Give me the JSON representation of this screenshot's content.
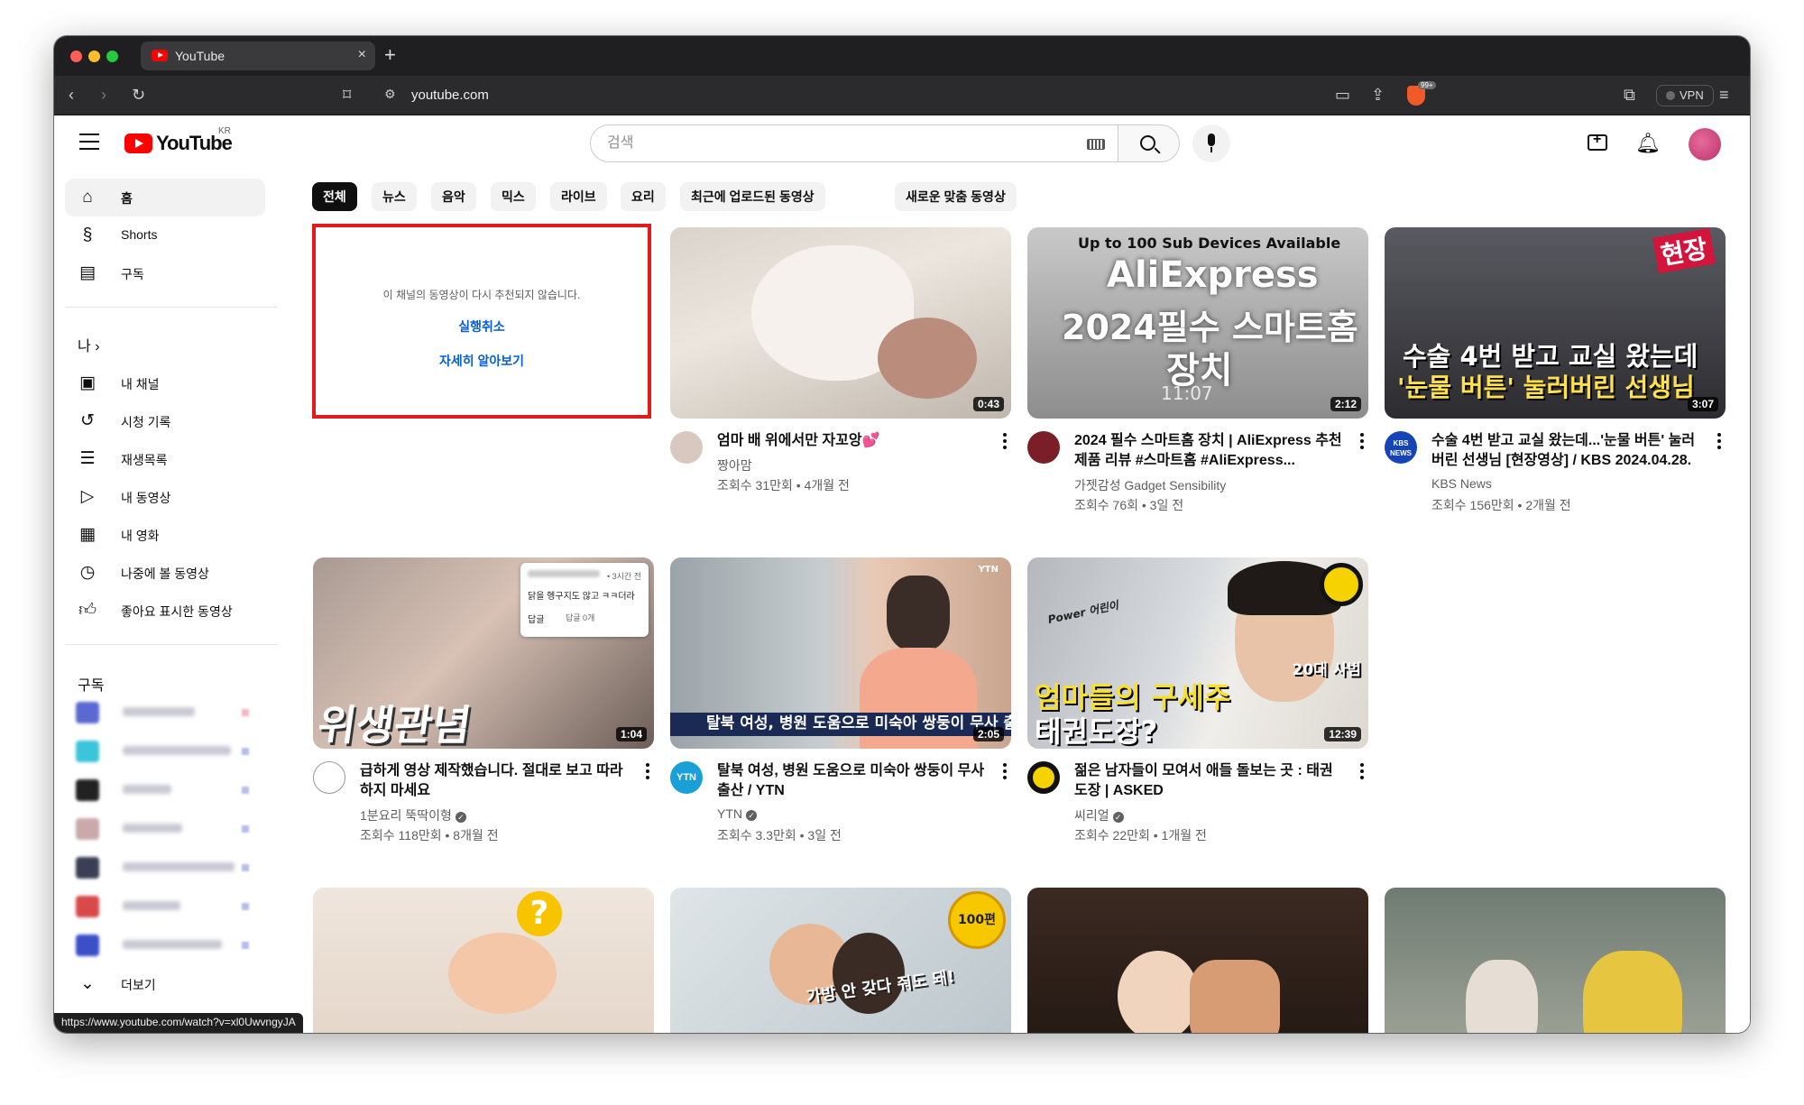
{
  "browser": {
    "tab_title": "YouTube",
    "tab_close": "×",
    "new_tab": "+",
    "address": "youtube.com",
    "vpn_label": "VPN",
    "brave_badge": "99+",
    "status_url": "https://www.youtube.com/watch?v=xl0UwvngyJA"
  },
  "masthead": {
    "logo_text": "YouTube",
    "region": "KR",
    "search_placeholder": "검색"
  },
  "sidebar": {
    "main": [
      {
        "label": "홈",
        "icon": "home-icon"
      },
      {
        "label": "Shorts",
        "icon": "shorts-icon"
      },
      {
        "label": "구독",
        "icon": "subscriptions-icon"
      }
    ],
    "you_heading": "나",
    "you_chevron": "›",
    "you": [
      {
        "label": "내 채널",
        "icon": "channel-icon"
      },
      {
        "label": "시청 기록",
        "icon": "history-icon"
      },
      {
        "label": "재생목록",
        "icon": "playlist-icon"
      },
      {
        "label": "내 동영상",
        "icon": "your-videos-icon"
      },
      {
        "label": "내 영화",
        "icon": "movies-icon"
      },
      {
        "label": "나중에 볼 동영상",
        "icon": "watch-later-icon"
      },
      {
        "label": "좋아요 표시한 동영상",
        "icon": "like-icon"
      }
    ],
    "subs_heading": "구독",
    "more_label": "더보기"
  },
  "chips": [
    "전체",
    "뉴스",
    "음악",
    "믹스",
    "라이브",
    "요리",
    "최근에 업로드된 동영상",
    "새로운 맞춤 동영상"
  ],
  "dismissed": {
    "message": "이 채널의 동영상이 다시 추천되지 않습니다.",
    "undo": "실행취소",
    "learn_more": "자세히 알아보기"
  },
  "videos": [
    {
      "title": "엄마 배 위에서만 자꼬앙💕",
      "channel": "짱아맘",
      "meta": "조회수 31만회 • 4개월 전",
      "duration": "0:43",
      "verified": false
    },
    {
      "title": "2024 필수 스마트홈 장치 | AliExpress 추천 제품 리뷰 #스마트홈 #AliExpress...",
      "channel": "가젯감성 Gadget Sensibility",
      "meta": "조회수 76회 • 3일 전",
      "duration": "2:12",
      "verified": false,
      "thumb_top": "Up to 100 Sub Devices Available",
      "thumb_line1": "AliExpress",
      "thumb_line2": "2024필수 스마트홈",
      "thumb_line3": "장치",
      "thumb_time": "11:07"
    },
    {
      "title": "수술 4번 받고 교실 왔는데...'눈물 버튼' 눌러버린 선생님 [현장영상] / KBS 2024.04.28.",
      "channel": "KBS News",
      "meta": "조회수 156만회 • 2개월 전",
      "duration": "3:07",
      "verified": false,
      "thumb_tag": "현장",
      "thumb_line1": "수술 4번 받고 교실 왔는데",
      "thumb_line2": "'눈물 버튼' 눌러버린 선생님",
      "avatar_text": "KBS NEWS"
    },
    {
      "title": "급하게 영상 제작했습니다. 절대로 보고 따라하지 마세요",
      "channel": "1분요리 뚝딱이형",
      "meta": "조회수 118만회 • 8개월 전",
      "duration": "1:04",
      "verified": true,
      "thumb_line1": "위생관념",
      "comment_time": "• 3시간 전",
      "comment_text": "닭을 헹구지도 않고 ㅋㅋ더라",
      "comment_reply": "답글",
      "comment_replies": "답글 0개"
    },
    {
      "title": "탈북 여성, 병원 도움으로 미숙아 쌍둥이 무사 출산 / YTN",
      "channel": "YTN",
      "meta": "조회수 3.3만회 • 3일 전",
      "duration": "2:05",
      "verified": true,
      "thumb_line1": "탈북 여성, 병원 도움으로 미숙아 쌍둥이 무사 출산",
      "thumb_corner": "YTN",
      "avatar_text": "YTN"
    },
    {
      "title": "젊은 남자들이 모여서 애들 돌보는 곳 : 태권도장 | ASKED",
      "channel": "씨리얼",
      "meta": "조회수 22만회 • 1개월 전",
      "duration": "12:39",
      "verified": true,
      "thumb_line1": "엄마들의 구세주",
      "thumb_line2": "태권도장?",
      "thumb_tag": "20대 사범",
      "thumb_hand": "Power 어린이"
    },
    {
      "title": "",
      "thumb_mark": "?"
    },
    {
      "title": "",
      "thumb_badge": "100편",
      "thumb_line1": "가방 안 갖다 줘도 돼!"
    },
    {
      "title": ""
    },
    {
      "title": ""
    }
  ],
  "colors": {
    "accent_red": "#ff0000",
    "highlight_box": "#e21a1a",
    "link_blue": "#065fd4"
  }
}
